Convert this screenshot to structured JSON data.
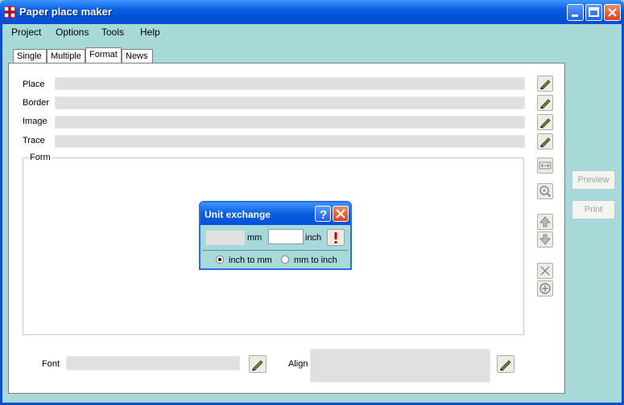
{
  "window": {
    "title": "Paper place maker"
  },
  "menu": [
    "Project",
    "Options",
    "Tools",
    "Help"
  ],
  "tabs": [
    "Single",
    "Multiple",
    "Format",
    "News"
  ],
  "active_tab": "Format",
  "rows": [
    {
      "label": "Place",
      "value": ""
    },
    {
      "label": "Border",
      "value": ""
    },
    {
      "label": "Image",
      "value": ""
    },
    {
      "label": "Trace",
      "value": ""
    }
  ],
  "form_group": {
    "label": "Form"
  },
  "bottom": {
    "font_label": "Font",
    "font_value": "",
    "align_label": "Align",
    "align_value": ""
  },
  "side_buttons": {
    "preview": "Preview",
    "print": "Print"
  },
  "dialog": {
    "title": "Unit exchange",
    "mm_value": "",
    "mm_label": "mm",
    "inch_value": "",
    "inch_label": "inch",
    "options": [
      {
        "label": "inch to mm",
        "selected": true
      },
      {
        "label": "mm to inch",
        "selected": false
      }
    ]
  }
}
